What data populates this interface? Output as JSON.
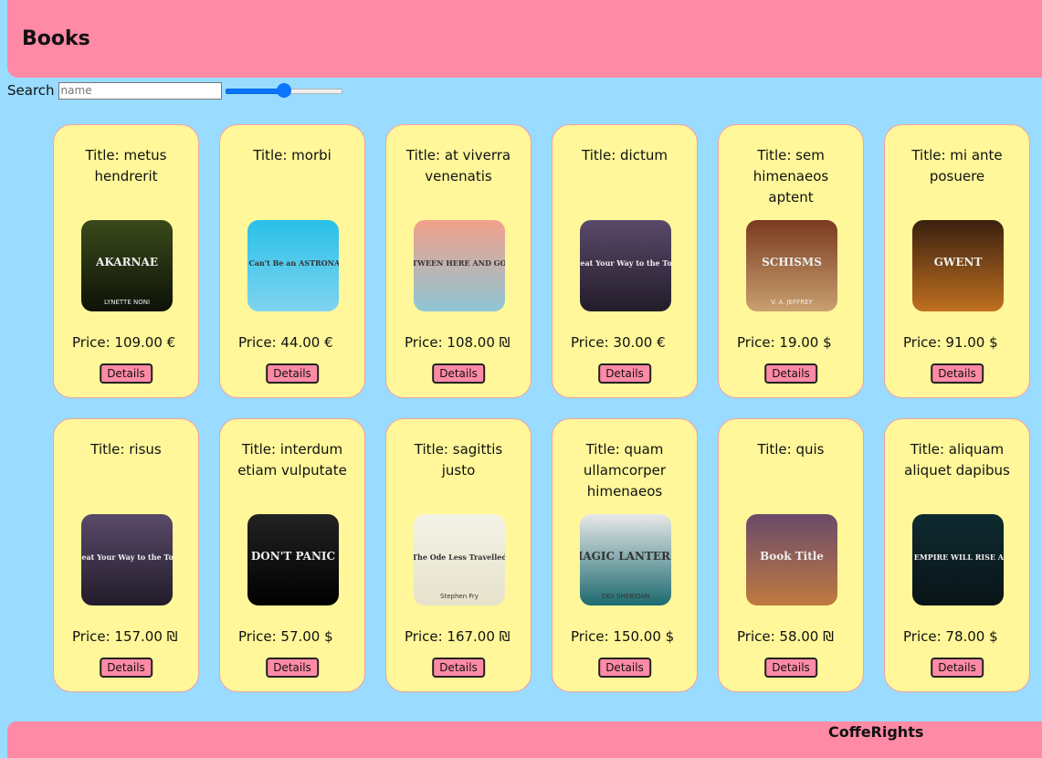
{
  "header": {
    "title": "Books"
  },
  "search": {
    "label": "Search",
    "placeholder": "name",
    "value": "",
    "slider_fraction": 0.5
  },
  "details_label": "Details",
  "books": [
    {
      "title": "Title: metus hendrerit",
      "price": "Price: 109.00 €",
      "cover_text": "AKARNAE",
      "cover_sub": "LYNETTE NONI",
      "cover_colors": [
        "#3a4a1a",
        "#0e1208"
      ]
    },
    {
      "title": "Title: morbi",
      "price": "Price: 44.00 €",
      "cover_text": "You Can't Be an ASTRONAUT!",
      "cover_sub": "",
      "cover_colors": [
        "#29c0e8",
        "#7fd4f0"
      ]
    },
    {
      "title": "Title: at viverra venenatis",
      "price": "Price: 108.00 ₪",
      "cover_text": "BETWEEN HERE AND GONE",
      "cover_sub": "",
      "cover_colors": [
        "#f3a08a",
        "#8fc6d6"
      ]
    },
    {
      "title": "Title: dictum",
      "price": "Price: 30.00 €",
      "cover_text": "Beat Your Way to the Top",
      "cover_sub": "",
      "cover_colors": [
        "#5a4a6a",
        "#221c2a"
      ]
    },
    {
      "title": "Title: sem himenaeos aptent",
      "price": "Price: 19.00 $",
      "cover_text": "SCHISMS",
      "cover_sub": "V. A. JEFFREY",
      "cover_colors": [
        "#7a3a20",
        "#c9a070"
      ]
    },
    {
      "title": "Title: mi ante posuere",
      "price": "Price: 91.00 $",
      "cover_text": "GWENT",
      "cover_sub": "",
      "cover_colors": [
        "#3a2010",
        "#c07020"
      ]
    },
    {
      "title": "Title: risus",
      "price": "Price: 157.00 ₪",
      "cover_text": "Beat Your Way to the Top",
      "cover_sub": "",
      "cover_colors": [
        "#5a4a6a",
        "#221c2a"
      ]
    },
    {
      "title": "Title: interdum etiam vulputate",
      "price": "Price: 57.00 $",
      "cover_text": "DON'T PANIC",
      "cover_sub": "",
      "cover_colors": [
        "#222222",
        "#000000"
      ]
    },
    {
      "title": "Title: sagittis justo",
      "price": "Price: 167.00 ₪",
      "cover_text": "The Ode Less Travelled",
      "cover_sub": "Stephen Fry",
      "cover_colors": [
        "#f4f2e6",
        "#e6e2cc"
      ]
    },
    {
      "title": "Title: quam ullamcorper himenaeos",
      "price": "Price: 150.00 $",
      "cover_text": "MAGIC LANTERN",
      "cover_sub": "DES SHERIDAN",
      "cover_colors": [
        "#e8e8e8",
        "#1c6a70"
      ]
    },
    {
      "title": "Title: quis",
      "price": "Price: 58.00 ₪",
      "cover_text": "Book Title",
      "cover_sub": "",
      "cover_colors": [
        "#6a4a6a",
        "#c07a40"
      ]
    },
    {
      "title": "Title: aliquam aliquet dapibus",
      "price": "Price: 78.00 $",
      "cover_text": "SITH EMPIRE WILL RISE AGAIN",
      "cover_sub": "",
      "cover_colors": [
        "#0e2a30",
        "#0a1418"
      ]
    }
  ],
  "footer": {
    "text": "CoffeRights"
  }
}
